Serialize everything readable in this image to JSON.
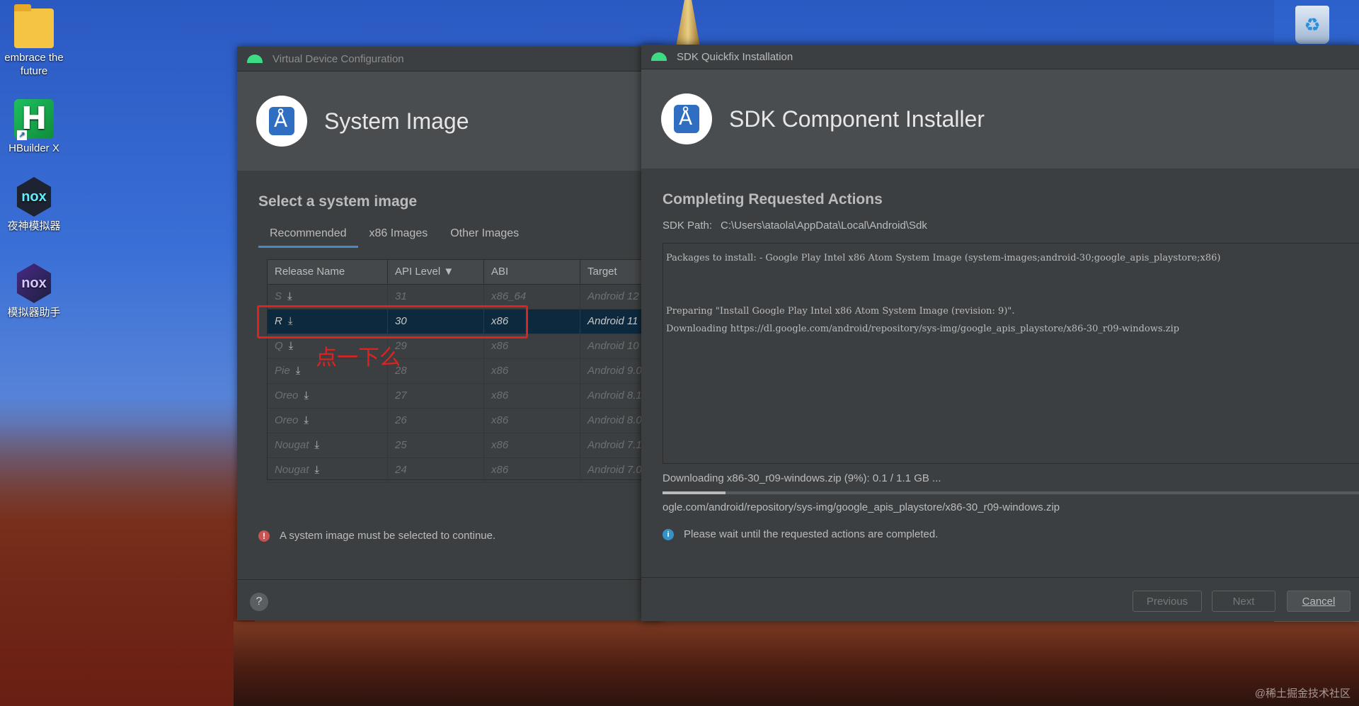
{
  "desktop": {
    "icons": [
      {
        "label": "embrace the future"
      },
      {
        "label": "HBuilder X",
        "glyph": "H"
      },
      {
        "label": "夜神模拟器",
        "glyph": "nox"
      },
      {
        "label": "模拟器助手",
        "glyph": "nox"
      }
    ],
    "watermark": "@稀土掘金技术社区"
  },
  "vdc": {
    "window_title": "Virtual Device Configuration",
    "banner_title": "System Image",
    "section_title": "Select a system image",
    "tabs": [
      {
        "label": "Recommended",
        "active": true
      },
      {
        "label": "x86 Images",
        "active": false
      },
      {
        "label": "Other Images",
        "active": false
      }
    ],
    "table": {
      "headers": [
        "Release Name",
        "API Level ▼",
        "ABI",
        "Target"
      ],
      "rows": [
        {
          "name": "S",
          "api": "31",
          "abi": "x86_64",
          "target": "Android 12"
        },
        {
          "name": "R",
          "api": "30",
          "abi": "x86",
          "target": "Android 11"
        },
        {
          "name": "Q",
          "api": "29",
          "abi": "x86",
          "target": "Android 10"
        },
        {
          "name": "Pie",
          "api": "28",
          "abi": "x86",
          "target": "Android 9.0"
        },
        {
          "name": "Oreo",
          "api": "27",
          "abi": "x86",
          "target": "Android 8.1"
        },
        {
          "name": "Oreo",
          "api": "26",
          "abi": "x86",
          "target": "Android 8.0"
        },
        {
          "name": "Nougat",
          "api": "25",
          "abi": "x86",
          "target": "Android 7.1"
        },
        {
          "name": "Nougat",
          "api": "24",
          "abi": "x86",
          "target": "Android 7.0"
        }
      ]
    },
    "annotation": "点一下么",
    "error_text": "A system image must be selected to continue.",
    "help_label": "?"
  },
  "sdk": {
    "window_title": "SDK Quickfix Installation",
    "banner_title": "SDK Component Installer",
    "section_title": "Completing Requested Actions",
    "sdk_path_label": "SDK Path:",
    "sdk_path_value": "C:\\Users\\ataola\\AppData\\Local\\Android\\Sdk",
    "log_lines": [
      "Packages to install: - Google Play Intel x86 Atom System Image (system-images;android-30;google_apis_playstore;x86)",
      "Preparing \"Install Google Play Intel x86 Atom System Image (revision: 9)\".",
      "Downloading https://dl.google.com/android/repository/sys-img/google_apis_playstore/x86-30_r09-windows.zip"
    ],
    "progress_text": "Downloading x86-30_r09-windows.zip (9%): 0.1 / 1.1 GB ...",
    "progress_percent": 9,
    "url_line": "ogle.com/android/repository/sys-img/google_apis_playstore/x86-30_r09-windows.zip",
    "info_text": "Please wait until the requested actions are completed.",
    "buttons": {
      "previous": "Previous",
      "next": "Next",
      "cancel": "Cancel"
    }
  },
  "icons": {
    "android": "android-icon",
    "download": "download-icon",
    "error": "error-icon",
    "info": "info-icon",
    "help": "help-icon",
    "recycle": "recycle-bin-icon"
  },
  "colors": {
    "accent": "#4a88c7",
    "selection": "#0d293e",
    "annotation_red": "#e0221f",
    "android_green": "#3ddc84"
  }
}
